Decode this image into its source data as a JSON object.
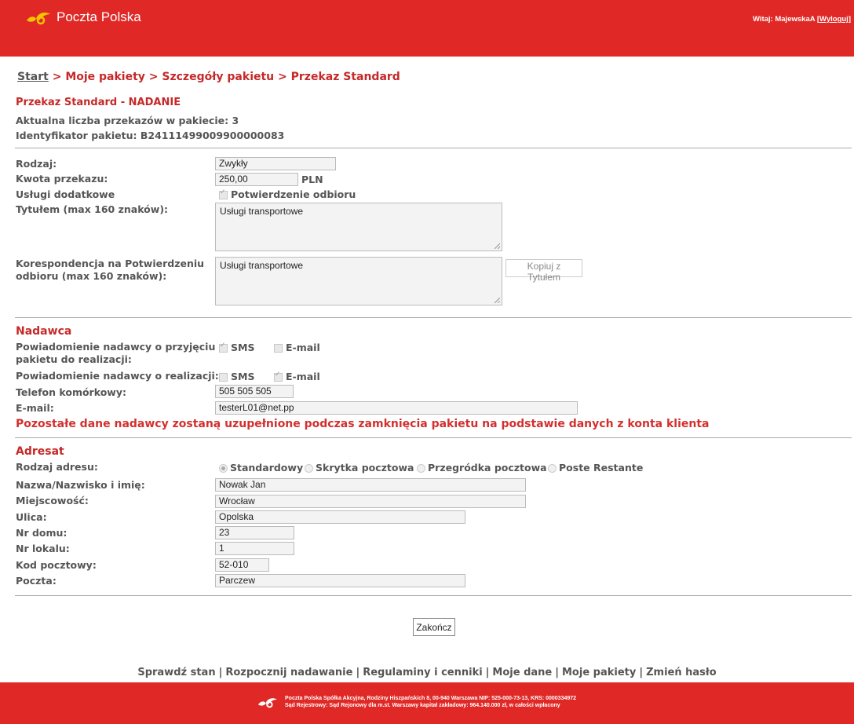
{
  "header": {
    "brand": "Poczta Polska",
    "welcome_prefix": "Witaj: MajewskaA",
    "logout": "Wyloguj",
    "colors": {
      "brand_red": "#e02926",
      "logo_yellow": "#f5c400"
    }
  },
  "breadcrumb": {
    "start": "Start",
    "sep": " > ",
    "items": [
      "Moje pakiety",
      "Szczegóły pakietu",
      "Przekaz Standard"
    ]
  },
  "section_title": "Przekaz Standard - NADANIE",
  "info": {
    "count": "Aktualna liczba przekazów w pakiecie: 3",
    "package_id": "Identyfikator pakietu: B24111499009900000083"
  },
  "transfer": {
    "type_label": "Rodzaj:",
    "type_value": "Zwykły",
    "amount_label": "Kwota przekazu:",
    "amount_value": "250,00",
    "currency": "PLN",
    "services_label": "Usługi dodatkowe",
    "services_option": "Potwierdzenie odbioru",
    "title_label": "Tytułem (max 160 znaków):",
    "title_value": "Usługi transportowe",
    "corr_label_1": "Korespondencja na Potwierdzeniu",
    "corr_label_2": "odbioru (max 160 znaków):",
    "corr_value": "Usługi transportowe",
    "copy_button": "Kopiuj z Tytułem"
  },
  "sender": {
    "heading": "Nadawca",
    "notify_accept_1": "Powiadomienie nadawcy o przyjęciu",
    "notify_accept_2": "pakietu do realizacji:",
    "notify_exec": "Powiadomienie nadawcy o realizacji:",
    "sms": "SMS",
    "email": "E-mail",
    "phone_label": "Telefon komórkowy:",
    "phone_value": "505 505 505",
    "email_label": "E-mail:",
    "email_value": "testerL01@net.pp",
    "note": "Pozostałe dane nadawcy zostaną uzupełnione podczas zamknięcia pakietu na podstawie danych z konta klienta"
  },
  "recipient": {
    "heading": "Adresat",
    "addr_type_label": "Rodzaj adresu:",
    "addr_types": [
      "Standardowy",
      "Skrytka pocztowa",
      "Przegródka pocztowa",
      "Poste Restante"
    ],
    "name_label": "Nazwa/Nazwisko i imię:",
    "name_value": "Nowak Jan",
    "city_label": "Miejscowość:",
    "city_value": "Wrocław",
    "street_label": "Ulica:",
    "street_value": "Opolska",
    "house_label": "Nr domu:",
    "house_value": "23",
    "flat_label": "Nr lokalu:",
    "flat_value": "1",
    "zip_label": "Kod pocztowy:",
    "zip_value": "52-010",
    "post_label": "Poczta:",
    "post_value": "Parczew"
  },
  "finish_button": "Zakończ",
  "footer": {
    "links": [
      "Sprawdź stan",
      "Rozpocznij nadawanie",
      "Regulaminy i cenniki",
      "Moje dane",
      "Moje pakiety",
      "Zmień hasło"
    ],
    "line1": "Poczta Polska Spółka Akcyjna, Rodziny Hiszpańskich 8, 00-940 Warszawa NIP: 525-000-73-13, KRS: 0000334972",
    "line2": "Sąd Rejestrowy: Sąd Rejonowy dla m.st. Warszawy kapitał zakładowy: 964.140.000 zł, w całości wpłacony"
  }
}
